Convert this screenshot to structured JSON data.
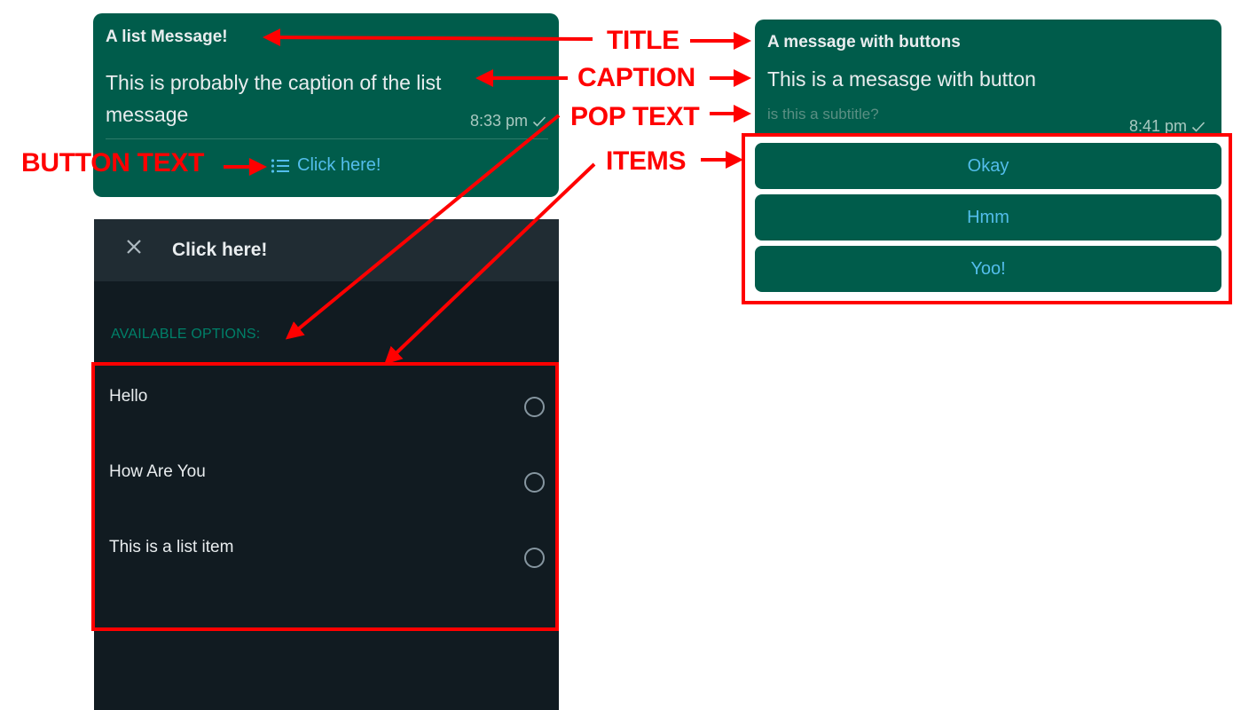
{
  "list_message": {
    "title": "A list Message!",
    "caption": "This is probably the caption of the list message",
    "time": "8:33 pm",
    "status_icon": "single-check-icon",
    "button_text": "Click here!",
    "button_icon": "list-icon"
  },
  "buttons_message": {
    "title": "A message with buttons",
    "caption": "This is a mesasge with button",
    "subtitle": "is this a subtitle?",
    "time": "8:41 pm",
    "status_icon": "single-check-icon",
    "buttons": [
      {
        "label": "Okay"
      },
      {
        "label": "Hmm"
      },
      {
        "label": "Yoo!"
      }
    ]
  },
  "list_popup": {
    "close_icon": "close-icon",
    "title": "Click here!",
    "section_title": "AVAILABLE OPTIONS:",
    "options": [
      {
        "label": "Hello"
      },
      {
        "label": "How Are You"
      },
      {
        "label": "This is a list item"
      }
    ]
  },
  "annotations": {
    "title": "TITLE",
    "caption": "CAPTION",
    "pop_text": "POP TEXT",
    "items": "ITEMS",
    "button_text": "BUTTON TEXT"
  },
  "colors": {
    "bubble": "#005c4b",
    "bubble_text": "#e9edef",
    "link": "#53bdeb",
    "popup_bg": "#111b21",
    "popup_header": "#202c33",
    "section_title": "#008069",
    "annotation": "#ff0000"
  }
}
